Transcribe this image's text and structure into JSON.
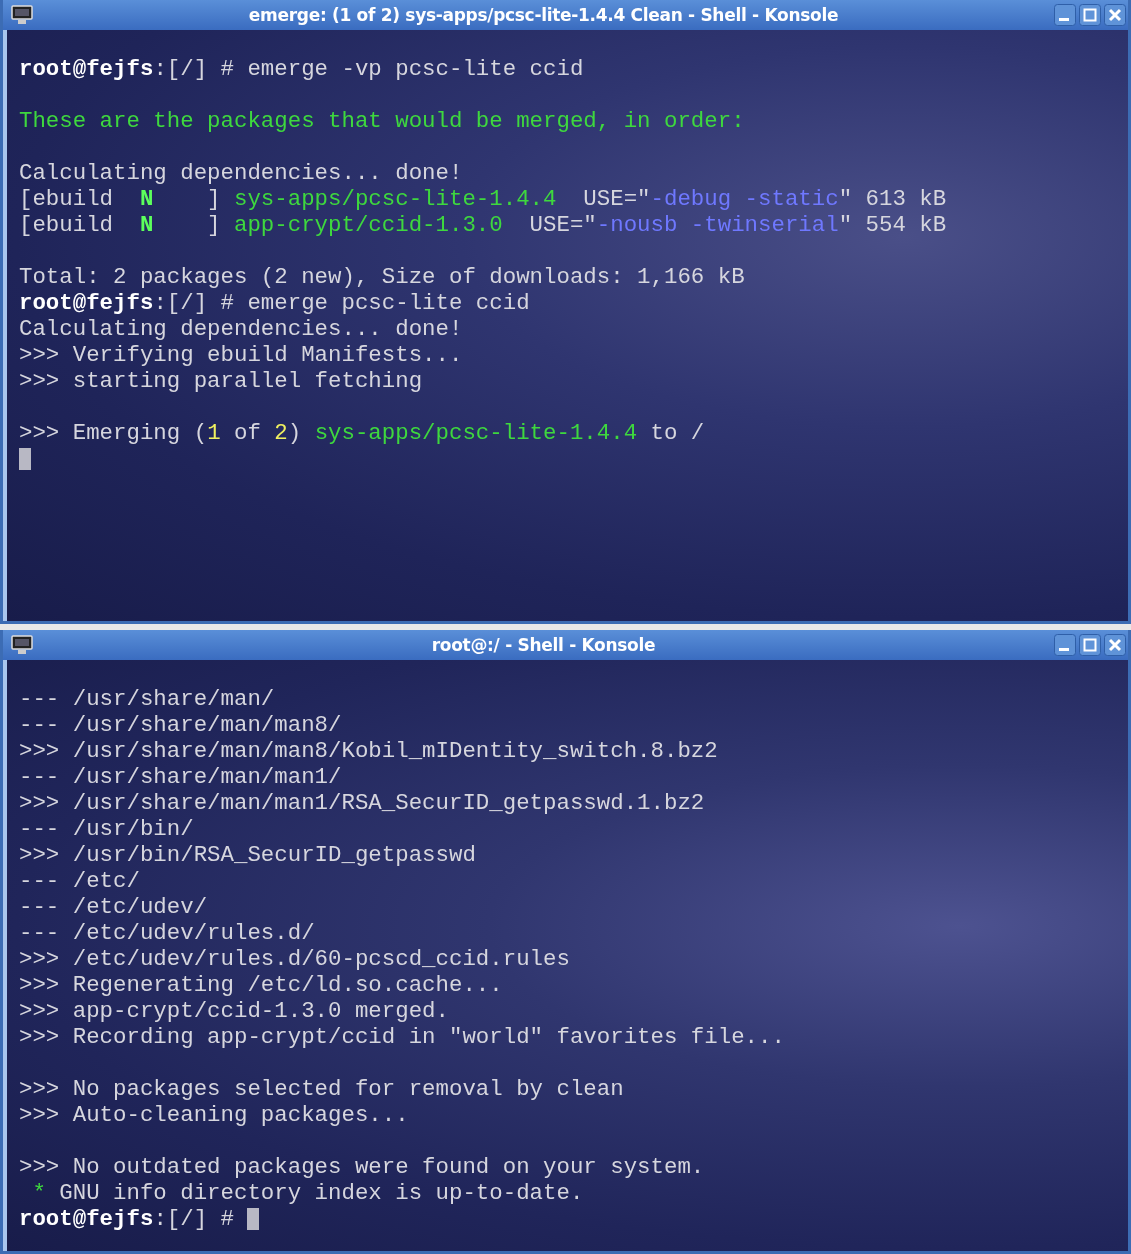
{
  "windows": [
    {
      "title": "emerge: (1 of 2) sys-apps/pcsc-lite-1.4.4 Clean - Shell - Konsole",
      "lines": [
        {
          "kind": "text",
          "segments": [
            {
              "kind": "bold",
              "text": "root@fejfs"
            },
            {
              "kind": "plain",
              "text": ":[/] # emerge -vp pcsc-lite ccid"
            }
          ]
        },
        {
          "kind": "blank"
        },
        {
          "kind": "text",
          "segments": [
            {
              "kind": "green",
              "text": "These are the packages that would be merged, in order:"
            }
          ]
        },
        {
          "kind": "blank"
        },
        {
          "kind": "text",
          "segments": [
            {
              "kind": "plain",
              "text": "Calculating dependencies... done!"
            }
          ]
        },
        {
          "kind": "text",
          "segments": [
            {
              "kind": "plain",
              "text": "[ebuild  "
            },
            {
              "kind": "bright_green",
              "text": "N"
            },
            {
              "kind": "plain",
              "text": "    ] "
            },
            {
              "kind": "green",
              "text": "sys-apps/pcsc-lite-1.4.4"
            },
            {
              "kind": "plain",
              "text": "  USE=\""
            },
            {
              "kind": "blue",
              "text": "-debug -static"
            },
            {
              "kind": "plain",
              "text": "\" 613 kB"
            }
          ]
        },
        {
          "kind": "text",
          "segments": [
            {
              "kind": "plain",
              "text": "[ebuild  "
            },
            {
              "kind": "bright_green",
              "text": "N"
            },
            {
              "kind": "plain",
              "text": "    ] "
            },
            {
              "kind": "green",
              "text": "app-crypt/ccid-1.3.0"
            },
            {
              "kind": "plain",
              "text": "  USE=\""
            },
            {
              "kind": "blue",
              "text": "-nousb -twinserial"
            },
            {
              "kind": "plain",
              "text": "\" 554 kB"
            }
          ]
        },
        {
          "kind": "blank"
        },
        {
          "kind": "text",
          "segments": [
            {
              "kind": "plain",
              "text": "Total: 2 packages (2 new), Size of downloads: 1,166 kB"
            }
          ]
        },
        {
          "kind": "text",
          "segments": [
            {
              "kind": "bold",
              "text": "root@fejfs"
            },
            {
              "kind": "plain",
              "text": ":[/] # emerge pcsc-lite ccid"
            }
          ]
        },
        {
          "kind": "text",
          "segments": [
            {
              "kind": "plain",
              "text": "Calculating dependencies... done!"
            }
          ]
        },
        {
          "kind": "text",
          "segments": [
            {
              "kind": "plain",
              "text": ">>> Verifying ebuild Manifests..."
            }
          ]
        },
        {
          "kind": "text",
          "segments": [
            {
              "kind": "plain",
              "text": ">>> starting parallel fetching"
            }
          ]
        },
        {
          "kind": "blank"
        },
        {
          "kind": "text",
          "segments": [
            {
              "kind": "plain",
              "text": ">>> Emerging ("
            },
            {
              "kind": "yellow",
              "text": "1"
            },
            {
              "kind": "plain",
              "text": " of "
            },
            {
              "kind": "yellow",
              "text": "2"
            },
            {
              "kind": "plain",
              "text": ") "
            },
            {
              "kind": "green",
              "text": "sys-apps/pcsc-lite-1.4.4"
            },
            {
              "kind": "plain",
              "text": " to /"
            }
          ]
        },
        {
          "kind": "cursor"
        }
      ]
    },
    {
      "title": "root@:/ - Shell - Konsole",
      "lines": [
        {
          "kind": "text",
          "segments": [
            {
              "kind": "plain",
              "text": "--- /usr/share/man/"
            }
          ]
        },
        {
          "kind": "text",
          "segments": [
            {
              "kind": "plain",
              "text": "--- /usr/share/man/man8/"
            }
          ]
        },
        {
          "kind": "text",
          "segments": [
            {
              "kind": "plain",
              "text": ">>> /usr/share/man/man8/Kobil_mIDentity_switch.8.bz2"
            }
          ]
        },
        {
          "kind": "text",
          "segments": [
            {
              "kind": "plain",
              "text": "--- /usr/share/man/man1/"
            }
          ]
        },
        {
          "kind": "text",
          "segments": [
            {
              "kind": "plain",
              "text": ">>> /usr/share/man/man1/RSA_SecurID_getpasswd.1.bz2"
            }
          ]
        },
        {
          "kind": "text",
          "segments": [
            {
              "kind": "plain",
              "text": "--- /usr/bin/"
            }
          ]
        },
        {
          "kind": "text",
          "segments": [
            {
              "kind": "plain",
              "text": ">>> /usr/bin/RSA_SecurID_getpasswd"
            }
          ]
        },
        {
          "kind": "text",
          "segments": [
            {
              "kind": "plain",
              "text": "--- /etc/"
            }
          ]
        },
        {
          "kind": "text",
          "segments": [
            {
              "kind": "plain",
              "text": "--- /etc/udev/"
            }
          ]
        },
        {
          "kind": "text",
          "segments": [
            {
              "kind": "plain",
              "text": "--- /etc/udev/rules.d/"
            }
          ]
        },
        {
          "kind": "text",
          "segments": [
            {
              "kind": "plain",
              "text": ">>> /etc/udev/rules.d/60-pcscd_ccid.rules"
            }
          ]
        },
        {
          "kind": "text",
          "segments": [
            {
              "kind": "plain",
              "text": ">>> Regenerating /etc/ld.so.cache..."
            }
          ]
        },
        {
          "kind": "text",
          "segments": [
            {
              "kind": "plain",
              "text": ">>> app-crypt/ccid-1.3.0 merged."
            }
          ]
        },
        {
          "kind": "text",
          "segments": [
            {
              "kind": "plain",
              "text": ">>> Recording app-crypt/ccid in \"world\" favorites file..."
            }
          ]
        },
        {
          "kind": "blank"
        },
        {
          "kind": "text",
          "segments": [
            {
              "kind": "plain",
              "text": ">>> No packages selected for removal by clean"
            }
          ]
        },
        {
          "kind": "text",
          "segments": [
            {
              "kind": "plain",
              "text": ">>> Auto-cleaning packages..."
            }
          ]
        },
        {
          "kind": "blank"
        },
        {
          "kind": "text",
          "segments": [
            {
              "kind": "plain",
              "text": ">>> No outdated packages were found on your system."
            }
          ]
        },
        {
          "kind": "indented_text",
          "segments": [
            {
              "kind": "green",
              "text": "*"
            },
            {
              "kind": "plain",
              "text": " GNU info directory index is up-to-date."
            }
          ]
        },
        {
          "kind": "text_cursor",
          "segments": [
            {
              "kind": "bold",
              "text": "root@fejfs"
            },
            {
              "kind": "plain",
              "text": ":[/] #"
            }
          ]
        }
      ]
    }
  ]
}
